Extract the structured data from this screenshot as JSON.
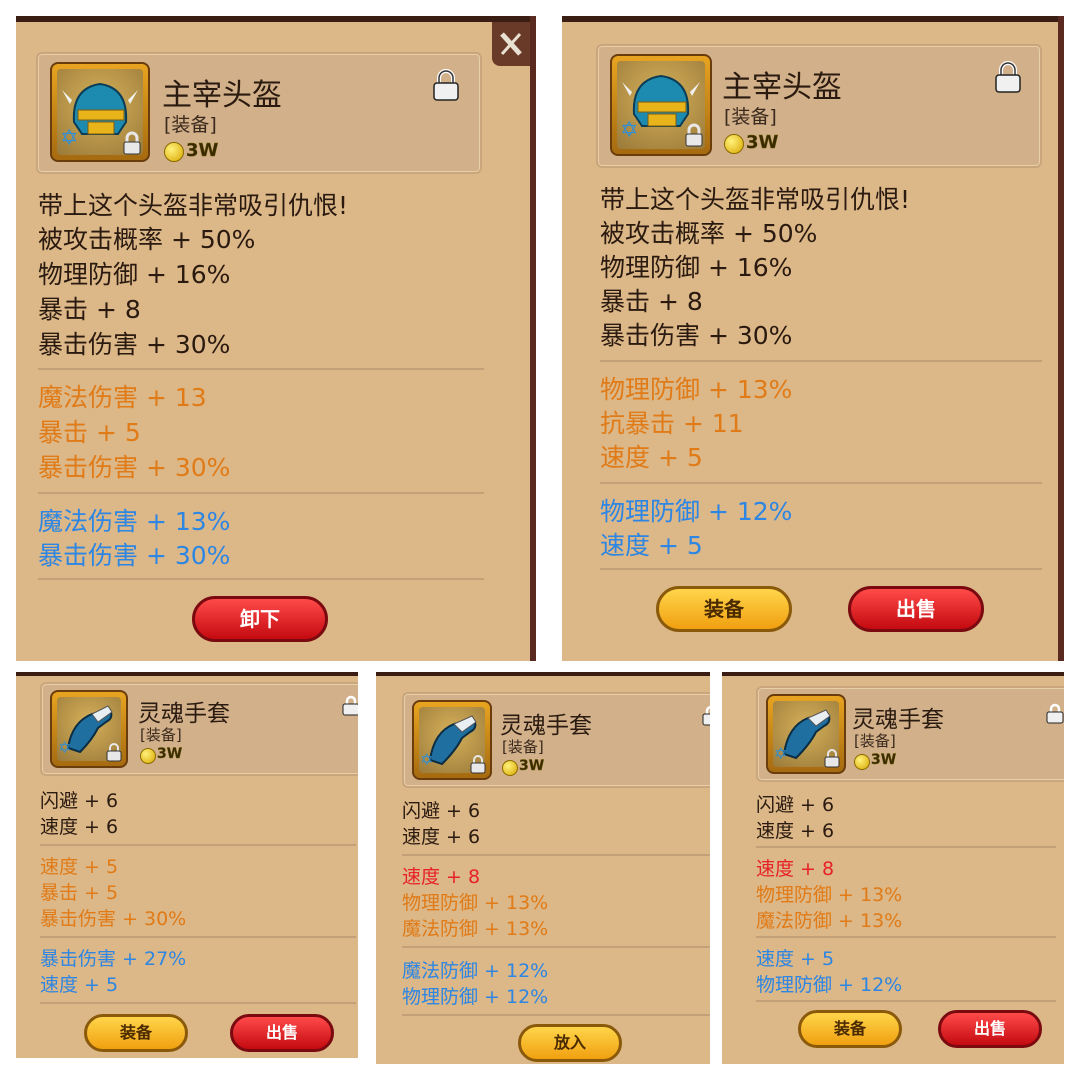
{
  "helmet": {
    "name": "主宰头盔",
    "type": "[装备]",
    "price": "3W",
    "description": "带上这个头盔非常吸引仇恨!",
    "base_stats": [
      "被攻击概率 + 50%",
      "物理防御 + 16%",
      "暴击 + 8",
      "暴击伤害 + 30%"
    ]
  },
  "panel1": {
    "orange_stats": [
      "魔法伤害 + 13",
      "暴击 + 5",
      "暴击伤害 + 30%"
    ],
    "blue_stats": [
      "魔法伤害 + 13%",
      "暴击伤害 + 30%"
    ],
    "button": "卸下"
  },
  "panel2": {
    "orange_stats": [
      "物理防御 + 13%",
      "抗暴击 + 11",
      "速度 + 5"
    ],
    "blue_stats": [
      "物理防御 + 12%",
      "速度 + 5"
    ],
    "buttons": [
      "装备",
      "出售"
    ]
  },
  "gloves": {
    "name": "灵魂手套",
    "type": "[装备]",
    "price": "3W",
    "base_stats": [
      "闪避 + 6",
      "速度 + 6"
    ]
  },
  "panel3": {
    "orange_stats": [
      "速度 + 5",
      "暴击 + 5",
      "暴击伤害 + 30%"
    ],
    "blue_stats": [
      "暴击伤害 + 27%",
      "速度 + 5"
    ],
    "buttons": [
      "装备",
      "出售"
    ]
  },
  "panel4": {
    "red_stat": "速度 + 8",
    "orange_stats": [
      "物理防御 + 13%",
      "魔法防御 + 13%"
    ],
    "blue_stats": [
      "魔法防御 + 12%",
      "物理防御 + 12%"
    ],
    "button": "放入"
  },
  "panel5": {
    "red_stat": "速度 + 8",
    "orange_stats": [
      "物理防御 + 13%",
      "魔法防御 + 13%"
    ],
    "blue_stats": [
      "速度 + 5",
      "物理防御 + 12%"
    ],
    "buttons": [
      "装备",
      "出售"
    ]
  },
  "colors": {
    "panel_bg": "#dcb787",
    "text_dark": "#2a1a10",
    "text_orange": "#e07b17",
    "text_blue": "#2d86e3",
    "text_red": "#e8212b"
  },
  "icons": [
    "helmet-icon",
    "gloves-icon",
    "lock-icon",
    "coin-icon",
    "star-badge-icon",
    "close-tab-icon"
  ]
}
